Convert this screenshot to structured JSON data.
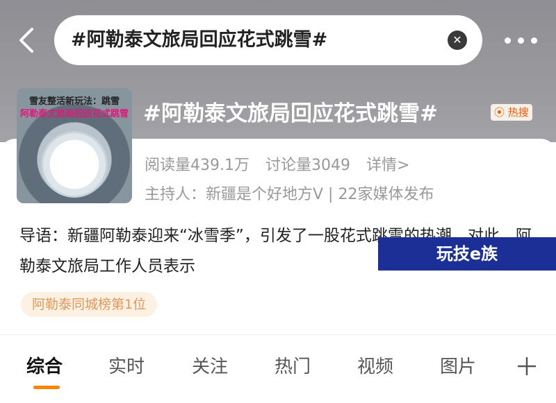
{
  "search": {
    "query": "#阿勒泰文旅局回应花式跳雪#",
    "clear_icon": "close-icon"
  },
  "header": {
    "back_icon": "chevron-left-icon",
    "more_icon": "more-horizontal-icon"
  },
  "topic": {
    "thumbnail": {
      "line1": "雪友整活新玩法：跳雪",
      "line2": "阿勒泰文旅局回应花式跳雪"
    },
    "title": "#阿勒泰文旅局回应花式跳雪#",
    "hot_badge": "热搜",
    "stats": {
      "reads": "阅读量439.1万",
      "discussions": "讨论量3049",
      "details": "详情>"
    },
    "host": "主持人：新疆是个好地方V | 22家媒体发布",
    "intro": "导语：新疆阿勒泰迎来“冰雪季”，引发了一股花式跳雪的热潮，对此，阿勒泰文旅局工作人员表示",
    "rank_badge": "阿勒泰同城榜第1位"
  },
  "watermark": "玩技e族",
  "tabs": [
    {
      "label": "综合",
      "active": true
    },
    {
      "label": "实时",
      "active": false
    },
    {
      "label": "关注",
      "active": false
    },
    {
      "label": "热门",
      "active": false
    },
    {
      "label": "视频",
      "active": false
    },
    {
      "label": "图片",
      "active": false
    }
  ],
  "tab_more_icon": "plus-icon",
  "colors": {
    "accent": "#ff8200",
    "hot": "#ff5a00",
    "rank_text": "#e2985a",
    "watermark_bg": "#1c2f96"
  }
}
